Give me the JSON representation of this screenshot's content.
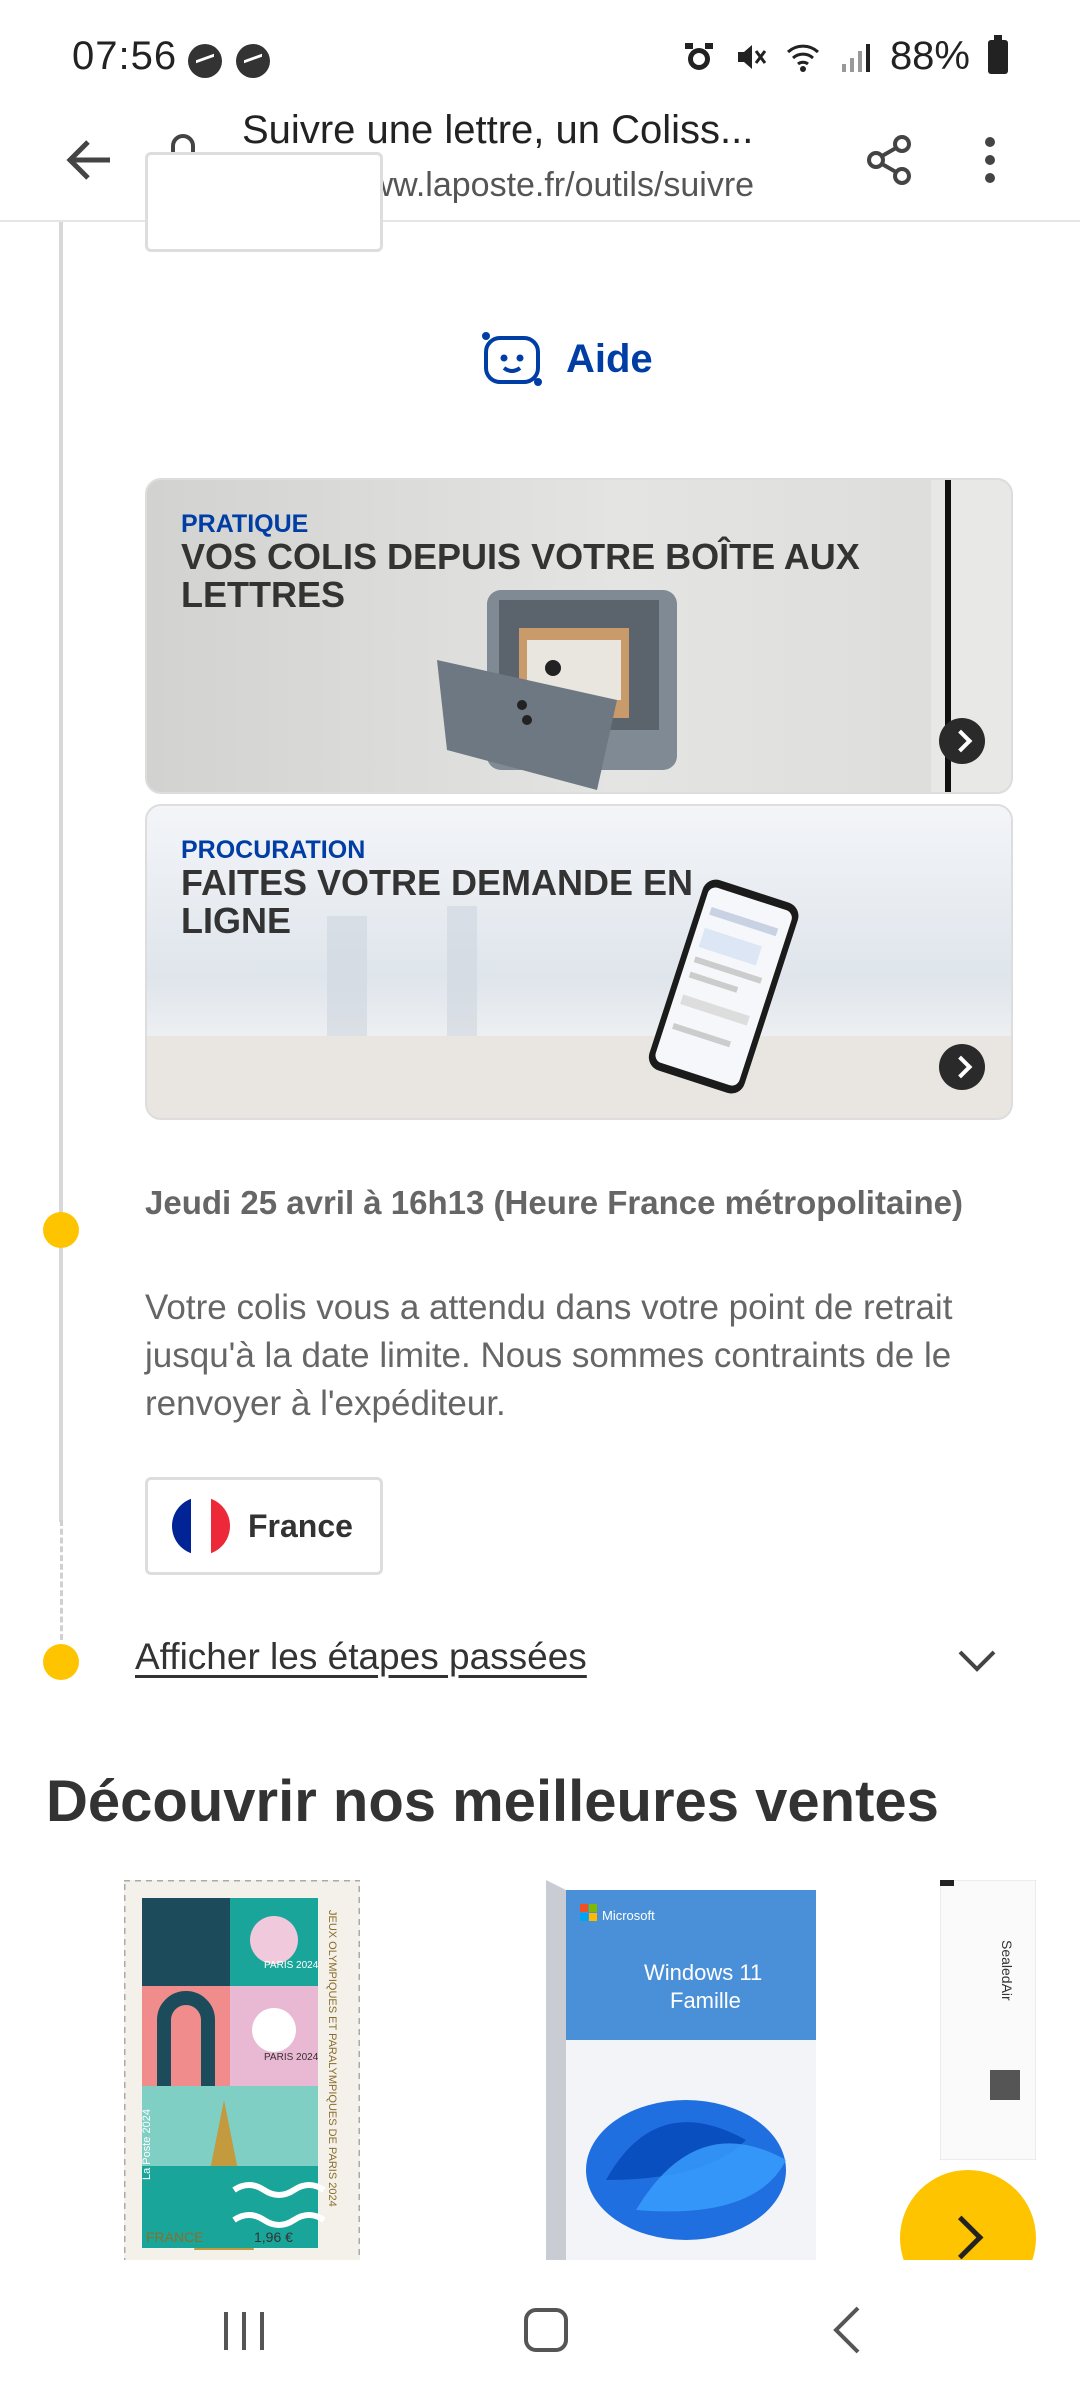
{
  "status_bar": {
    "time": "07:56",
    "battery": "88%"
  },
  "browser": {
    "page_title": "Suivre une lettre, un Coliss...",
    "url": "https://www.laposte.fr/outils/suivre"
  },
  "help": {
    "label": "Aide"
  },
  "promos": [
    {
      "kicker": "PRATIQUE",
      "title": "VOS COLIS DEPUIS VOTRE BOÎTE AUX LETTRES"
    },
    {
      "kicker": "PROCURATION",
      "title": "FAITES VOTRE DEMANDE EN LIGNE"
    }
  ],
  "event": {
    "date": "Jeudi 25 avril à 16h13 (Heure France métropolitaine)",
    "description": "Votre colis vous a attendu dans votre point de retrait jusqu'à la date limite. Nous sommes contraints de le renvoyer à l'expéditeur.",
    "country": "France"
  },
  "past_steps": {
    "label": "Afficher les étapes passées"
  },
  "best_sellers": {
    "title": "Découvrir nos meilleures ventes",
    "products": [
      {
        "name": "stamp",
        "line1": "PARIS 2024",
        "line2": "PARIS 2024",
        "side": "JEUX OLYMPIQUES ET PARALYMPIQUES DE PARIS 2024",
        "brand": "La Poste 2024",
        "country": "FRANCE",
        "price": "1,96 €"
      },
      {
        "name": "windows",
        "brand": "Microsoft",
        "title1": "Windows 11",
        "title2": "Famille"
      },
      {
        "name": "envelope",
        "brand": "SealedAir"
      }
    ]
  },
  "colors": {
    "accent_blue": "#003da5",
    "accent_yellow": "#ffc400"
  }
}
